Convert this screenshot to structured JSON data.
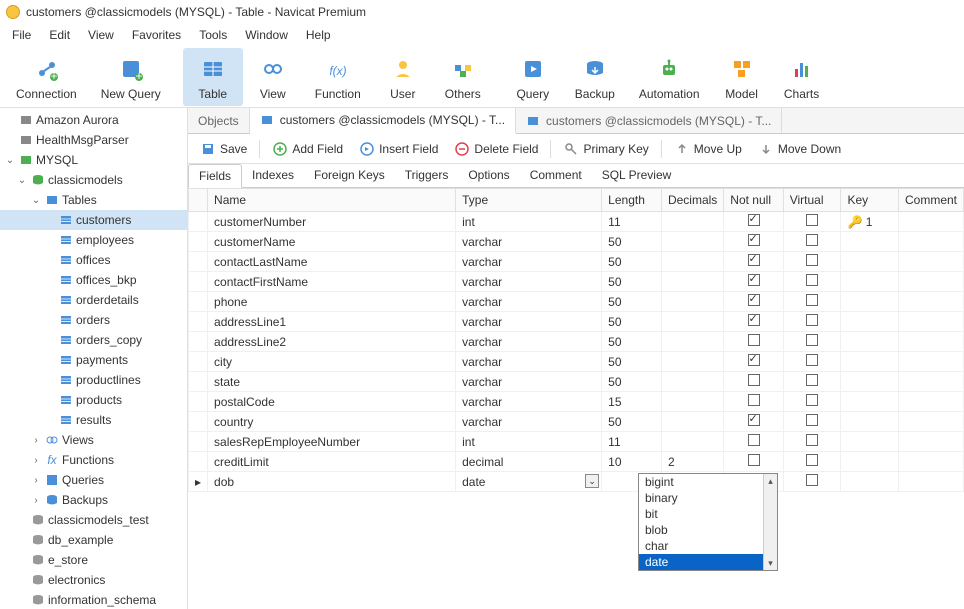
{
  "window_title": "customers @classicmodels (MYSQL) - Table - Navicat Premium",
  "menu": [
    "File",
    "Edit",
    "View",
    "Favorites",
    "Tools",
    "Window",
    "Help"
  ],
  "toolbar": [
    {
      "id": "connection",
      "label": "Connection"
    },
    {
      "id": "new-query",
      "label": "New Query"
    },
    {
      "id": "table",
      "label": "Table"
    },
    {
      "id": "view",
      "label": "View"
    },
    {
      "id": "function",
      "label": "Function"
    },
    {
      "id": "user",
      "label": "User"
    },
    {
      "id": "others",
      "label": "Others"
    },
    {
      "id": "query",
      "label": "Query"
    },
    {
      "id": "backup",
      "label": "Backup"
    },
    {
      "id": "automation",
      "label": "Automation"
    },
    {
      "id": "model",
      "label": "Model"
    },
    {
      "id": "charts",
      "label": "Charts"
    }
  ],
  "tree": {
    "amazon": "Amazon Aurora",
    "health": "HealthMsgParser",
    "mysql": "MYSQL",
    "classicmodels": "classicmodels",
    "tables": "Tables",
    "table_items": [
      "customers",
      "employees",
      "offices",
      "offices_bkp",
      "orderdetails",
      "orders",
      "orders_copy",
      "payments",
      "productlines",
      "products",
      "results"
    ],
    "views": "Views",
    "functions": "Functions",
    "queries": "Queries",
    "backups": "Backups",
    "other_dbs": [
      "classicmodels_test",
      "db_example",
      "e_store",
      "electronics",
      "information_schema"
    ]
  },
  "tabs": {
    "objects": "Objects",
    "t1": "customers @classicmodels (MYSQL) - T...",
    "t2": "customers @classicmodels (MYSQL) - T..."
  },
  "actions": {
    "save": "Save",
    "add": "Add Field",
    "insert": "Insert Field",
    "delete": "Delete Field",
    "pk": "Primary Key",
    "up": "Move Up",
    "down": "Move Down"
  },
  "subtabs": [
    "Fields",
    "Indexes",
    "Foreign Keys",
    "Triggers",
    "Options",
    "Comment",
    "SQL Preview"
  ],
  "grid": {
    "headers": {
      "name": "Name",
      "type": "Type",
      "length": "Length",
      "decimals": "Decimals",
      "notnull": "Not null",
      "virtual": "Virtual",
      "key": "Key",
      "comment": "Comment"
    },
    "rows": [
      {
        "name": "customerNumber",
        "type": "int",
        "length": "11",
        "decimals": "",
        "notnull": true,
        "virtual": false,
        "key": "1"
      },
      {
        "name": "customerName",
        "type": "varchar",
        "length": "50",
        "decimals": "",
        "notnull": true,
        "virtual": false,
        "key": ""
      },
      {
        "name": "contactLastName",
        "type": "varchar",
        "length": "50",
        "decimals": "",
        "notnull": true,
        "virtual": false,
        "key": ""
      },
      {
        "name": "contactFirstName",
        "type": "varchar",
        "length": "50",
        "decimals": "",
        "notnull": true,
        "virtual": false,
        "key": ""
      },
      {
        "name": "phone",
        "type": "varchar",
        "length": "50",
        "decimals": "",
        "notnull": true,
        "virtual": false,
        "key": ""
      },
      {
        "name": "addressLine1",
        "type": "varchar",
        "length": "50",
        "decimals": "",
        "notnull": true,
        "virtual": false,
        "key": ""
      },
      {
        "name": "addressLine2",
        "type": "varchar",
        "length": "50",
        "decimals": "",
        "notnull": false,
        "virtual": false,
        "key": ""
      },
      {
        "name": "city",
        "type": "varchar",
        "length": "50",
        "decimals": "",
        "notnull": true,
        "virtual": false,
        "key": ""
      },
      {
        "name": "state",
        "type": "varchar",
        "length": "50",
        "decimals": "",
        "notnull": false,
        "virtual": false,
        "key": ""
      },
      {
        "name": "postalCode",
        "type": "varchar",
        "length": "15",
        "decimals": "",
        "notnull": false,
        "virtual": false,
        "key": ""
      },
      {
        "name": "country",
        "type": "varchar",
        "length": "50",
        "decimals": "",
        "notnull": true,
        "virtual": false,
        "key": ""
      },
      {
        "name": "salesRepEmployeeNumber",
        "type": "int",
        "length": "11",
        "decimals": "",
        "notnull": false,
        "virtual": false,
        "key": ""
      },
      {
        "name": "creditLimit",
        "type": "decimal",
        "length": "10",
        "decimals": "2",
        "notnull": false,
        "virtual": false,
        "key": ""
      },
      {
        "name": "dob",
        "type": "date",
        "length": "",
        "decimals": "",
        "notnull": false,
        "virtual": false,
        "key": "",
        "editing": true
      }
    ]
  },
  "type_dropdown": [
    "bigint",
    "binary",
    "bit",
    "blob",
    "char",
    "date"
  ],
  "type_dropdown_selected": "date"
}
